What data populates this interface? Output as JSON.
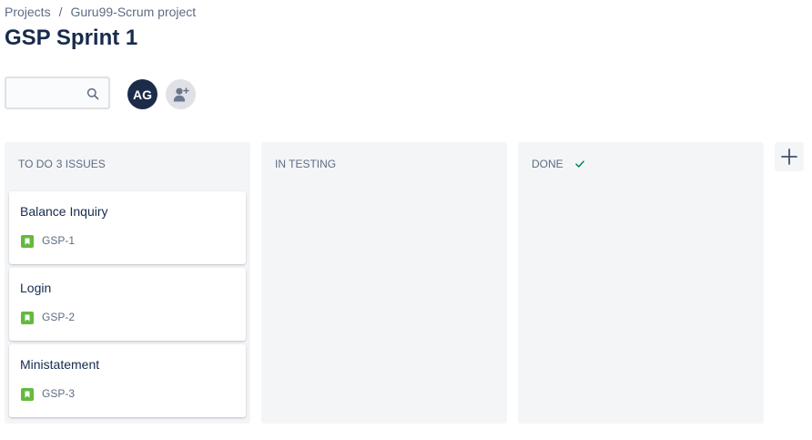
{
  "breadcrumb": {
    "items": [
      "Projects",
      "Guru99-Scrum project"
    ],
    "separator": "/"
  },
  "page": {
    "title": "GSP Sprint 1"
  },
  "search": {
    "value": "",
    "placeholder": "",
    "icon": "search-icon"
  },
  "people": {
    "avatar_initials": "AG",
    "avatar_color": "#1c2b4a",
    "add_icon": "add-person-icon"
  },
  "board": {
    "columns": [
      {
        "name": "TO DO",
        "count_label": "3 ISSUES",
        "cards": [
          {
            "title": "Balance Inquiry",
            "key": "GSP-1",
            "type_icon": "story-icon"
          },
          {
            "title": "Login",
            "key": "GSP-2",
            "type_icon": "story-icon"
          },
          {
            "title": "Ministatement",
            "key": "GSP-3",
            "type_icon": "story-icon"
          }
        ]
      },
      {
        "name": "IN TESTING",
        "cards": []
      },
      {
        "name": "DONE",
        "done_icon": "check-icon",
        "cards": []
      }
    ],
    "add_column_icon": "plus-icon"
  },
  "colors": {
    "story": "#63ba3c",
    "done_check": "#00875a",
    "column_bg": "#f4f5f7",
    "text_primary": "#172b4d",
    "text_secondary": "#5e6c84"
  }
}
